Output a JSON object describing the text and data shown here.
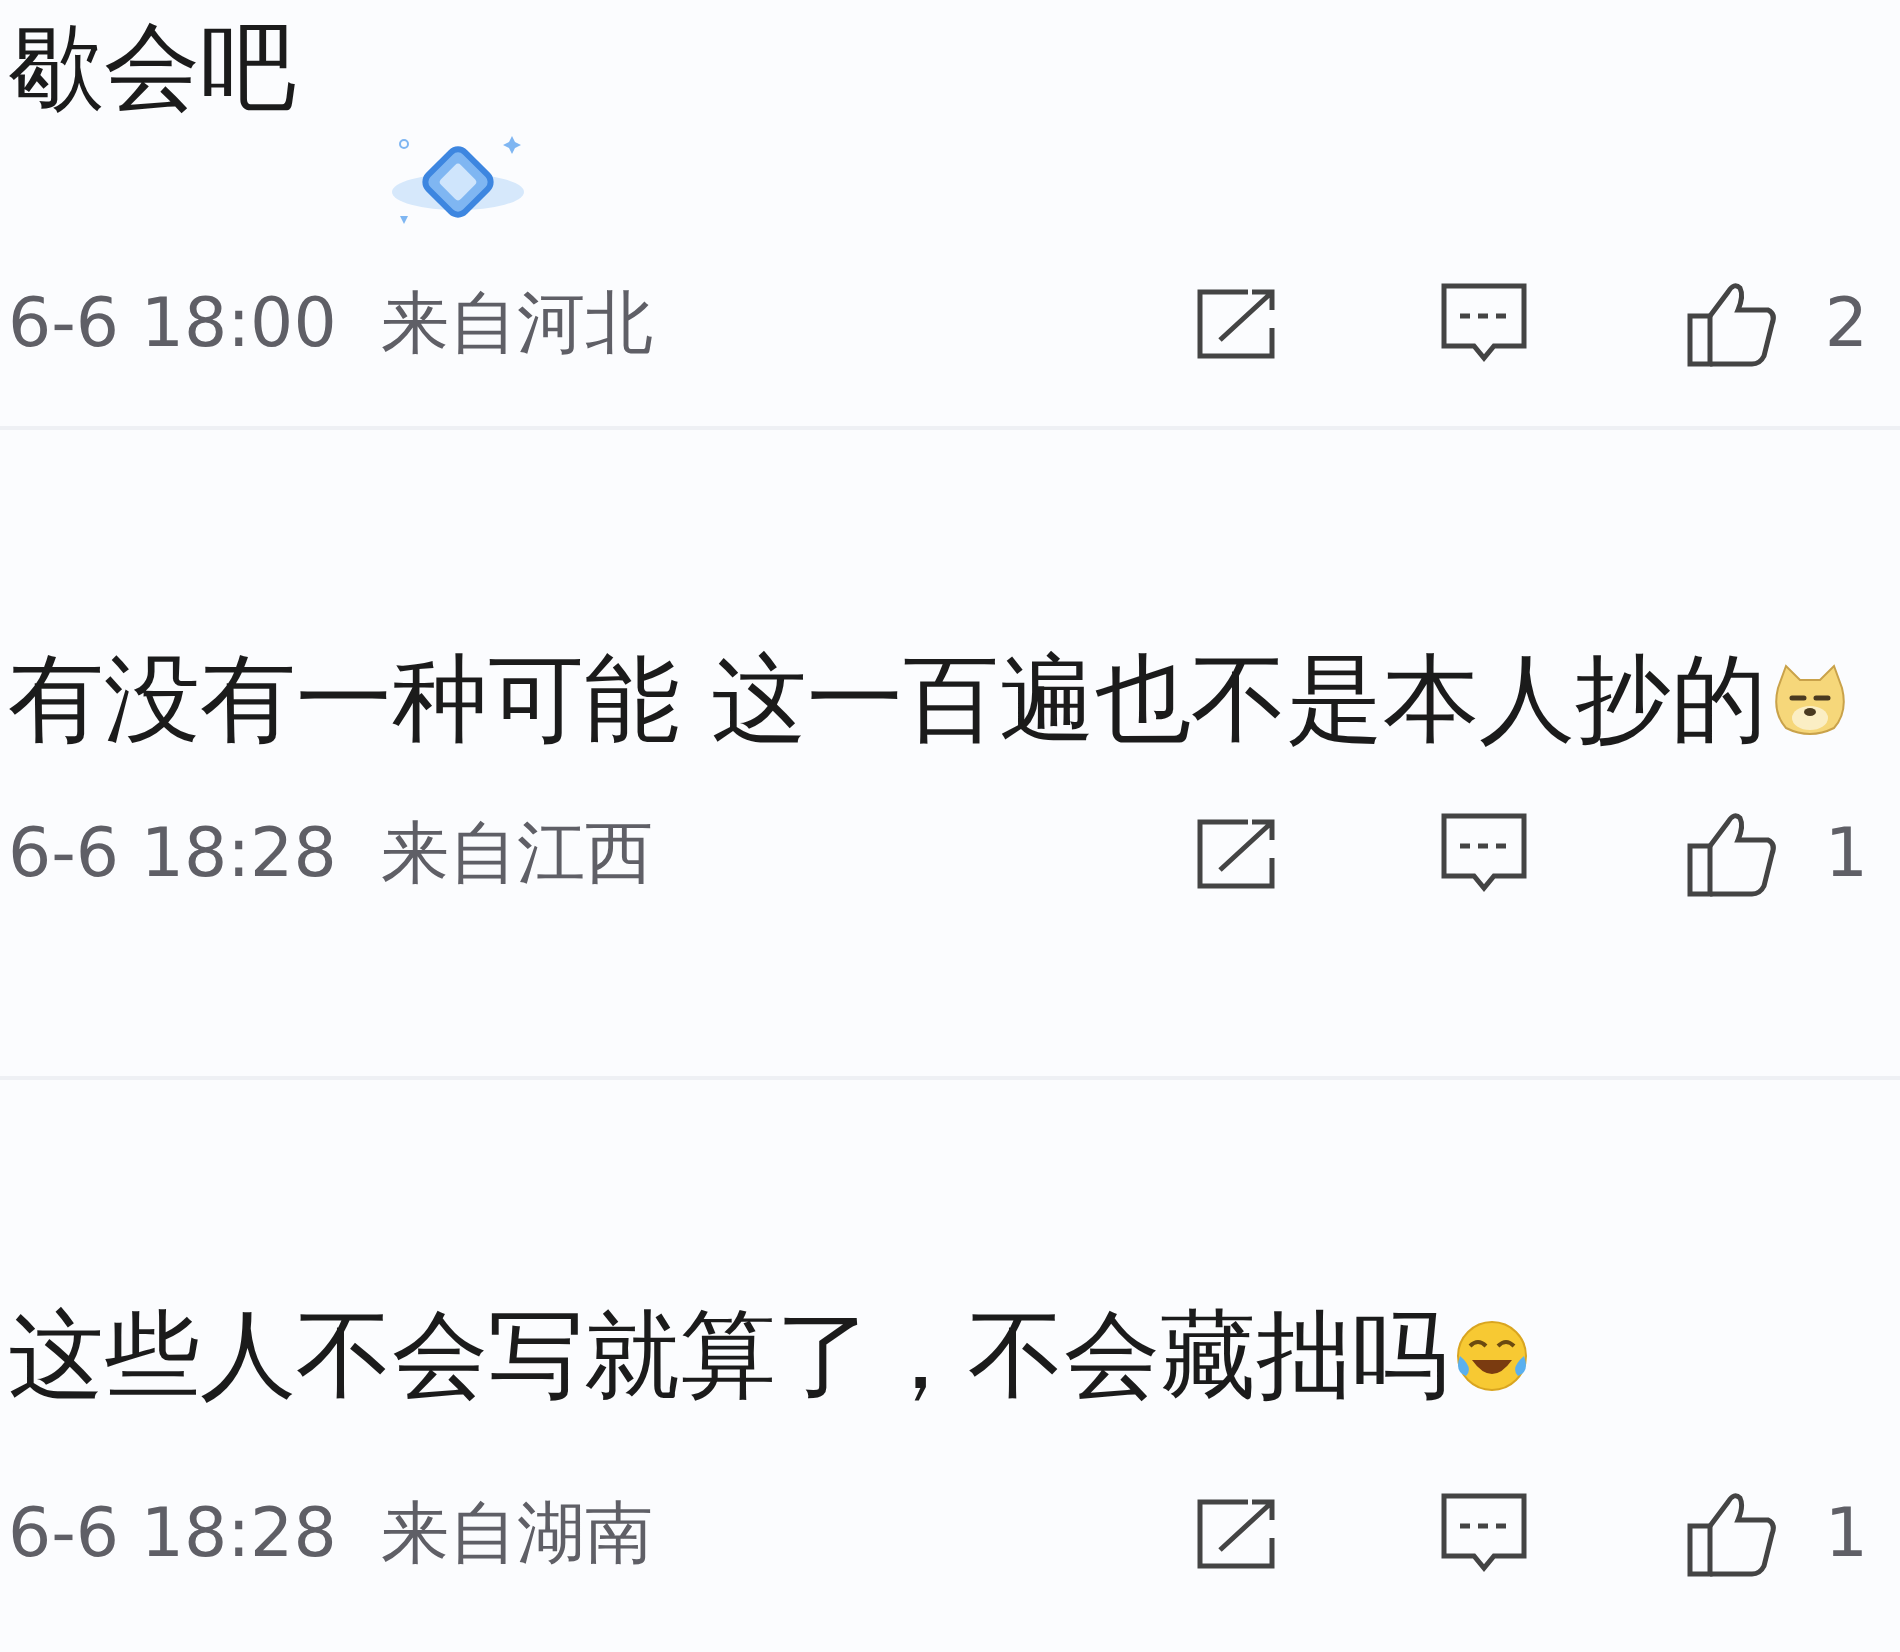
{
  "comments": [
    {
      "text": "歇会吧",
      "badge": true,
      "time": "6-6 18:00",
      "location": "来自河北",
      "likes": "2"
    },
    {
      "text": "有没有一种可能 这一百遍也不是本人抄的",
      "emojis": [
        {
          "kind": "doge"
        }
      ],
      "time": "6-6 18:28",
      "location": "来自江西",
      "likes": "1"
    },
    {
      "text": "这些人不会写就算了，不会藏拙吗",
      "emojis": [
        {
          "kind": "laugh-cry"
        }
      ],
      "time": "6-6 18:28",
      "location": "来自湖南",
      "likes": "1"
    }
  ]
}
